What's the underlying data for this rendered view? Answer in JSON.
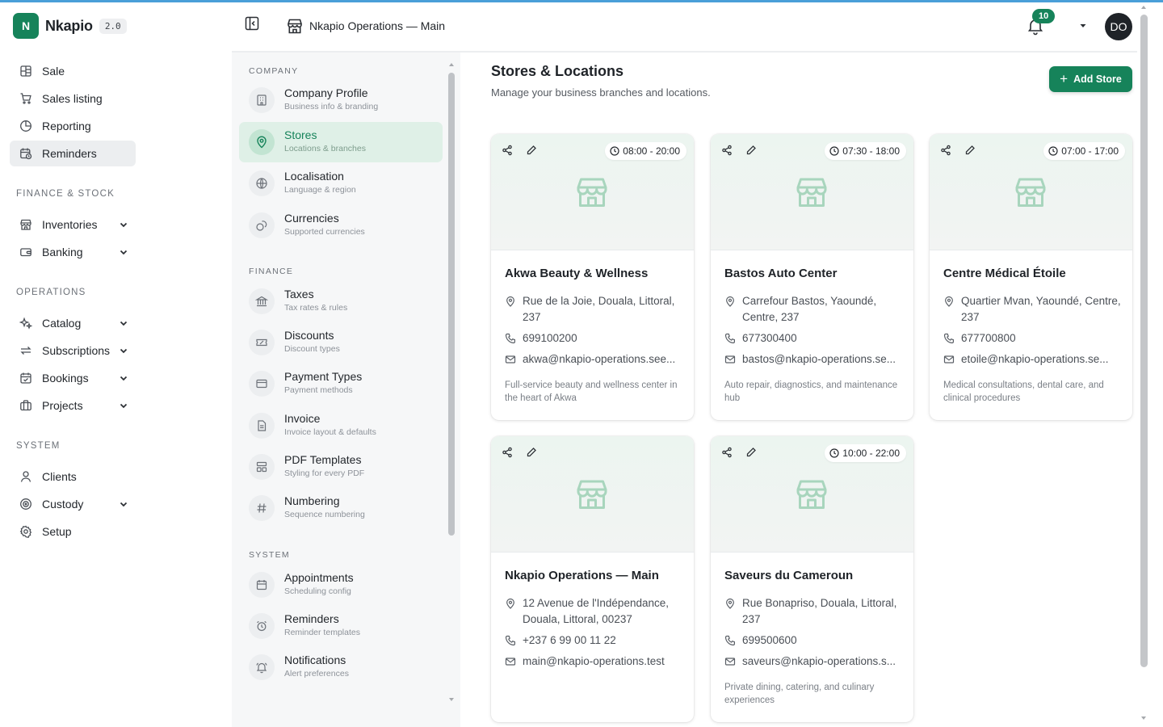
{
  "brand": {
    "logo_letter": "N",
    "name": "Nkapio",
    "version": "2.0"
  },
  "sidebar": {
    "items_top": [
      {
        "label": "Sale",
        "icon": "grid-icon"
      },
      {
        "label": "Sales listing",
        "icon": "cart-icon"
      },
      {
        "label": "Reporting",
        "icon": "pie-chart-icon"
      },
      {
        "label": "Reminders",
        "icon": "calendar-clock-icon",
        "active": true
      }
    ],
    "section_finance": "FINANCE & STOCK",
    "items_finance": [
      {
        "label": "Inventories",
        "icon": "store-icon"
      },
      {
        "label": "Banking",
        "icon": "wallet-icon"
      }
    ],
    "section_operations": "OPERATIONS",
    "items_operations": [
      {
        "label": "Catalog",
        "icon": "sparkle-icon"
      },
      {
        "label": "Subscriptions",
        "icon": "repeat-icon"
      },
      {
        "label": "Bookings",
        "icon": "calendar-check-icon"
      },
      {
        "label": "Projects",
        "icon": "briefcase-icon"
      }
    ],
    "section_system": "SYSTEM",
    "items_system": [
      {
        "label": "Clients",
        "icon": "user-icon"
      },
      {
        "label": "Custody",
        "icon": "target-icon"
      },
      {
        "label": "Setup",
        "icon": "gear-icon"
      }
    ]
  },
  "header": {
    "title": "Nkapio Operations — Main",
    "notifications": "10",
    "avatar": "DO"
  },
  "settings": {
    "section_company": "COMPANY",
    "company": [
      {
        "title": "Company Profile",
        "sub": "Business info & branding"
      },
      {
        "title": "Stores",
        "sub": "Locations & branches",
        "active": true
      },
      {
        "title": "Localisation",
        "sub": "Language & region"
      },
      {
        "title": "Currencies",
        "sub": "Supported currencies"
      }
    ],
    "section_finance": "FINANCE",
    "finance": [
      {
        "title": "Taxes",
        "sub": "Tax rates & rules"
      },
      {
        "title": "Discounts",
        "sub": "Discount types"
      },
      {
        "title": "Payment Types",
        "sub": "Payment methods"
      },
      {
        "title": "Invoice",
        "sub": "Invoice layout & defaults"
      },
      {
        "title": "PDF Templates",
        "sub": "Styling for every PDF"
      },
      {
        "title": "Numbering",
        "sub": "Sequence numbering"
      }
    ],
    "section_system": "SYSTEM",
    "system": [
      {
        "title": "Appointments",
        "sub": "Scheduling config"
      },
      {
        "title": "Reminders",
        "sub": "Reminder templates"
      },
      {
        "title": "Notifications",
        "sub": "Alert preferences"
      }
    ]
  },
  "main": {
    "title": "Stores & Locations",
    "subtitle": "Manage your business branches and locations.",
    "add_button": "Add Store",
    "stores": [
      {
        "name": "Akwa Beauty & Wellness",
        "hours": "08:00 - 20:00",
        "address": "Rue de la Joie, Douala, Littoral, 237",
        "phone": "699100200",
        "email": "akwa@nkapio-operations.see...",
        "description": "Full-service beauty and wellness center in the heart of Akwa"
      },
      {
        "name": "Bastos Auto Center",
        "hours": "07:30 - 18:00",
        "address": "Carrefour Bastos, Yaoundé, Centre, 237",
        "phone": "677300400",
        "email": "bastos@nkapio-operations.se...",
        "description": "Auto repair, diagnostics, and maintenance hub"
      },
      {
        "name": "Centre Médical Étoile",
        "hours": "07:00 - 17:00",
        "address": "Quartier Mvan, Yaoundé, Centre, 237",
        "phone": "677700800",
        "email": "etoile@nkapio-operations.se...",
        "description": "Medical consultations, dental care, and clinical procedures"
      },
      {
        "name": "Nkapio Operations — Main",
        "hours": "",
        "address": "12 Avenue de l'Indépendance, Douala, Littoral, 00237",
        "phone": "+237 6 99 00 11 22",
        "email": "main@nkapio-operations.test",
        "description": ""
      },
      {
        "name": "Saveurs du Cameroun",
        "hours": "10:00 - 22:00",
        "address": "Rue Bonapriso, Douala, Littoral, 237",
        "phone": "699500600",
        "email": "saveurs@nkapio-operations.s...",
        "description": "Private dining, catering, and culinary experiences"
      }
    ]
  },
  "colors": {
    "accent": "#16835a",
    "active_bg": "#dff0e7",
    "topline": "#4a9fd8"
  }
}
